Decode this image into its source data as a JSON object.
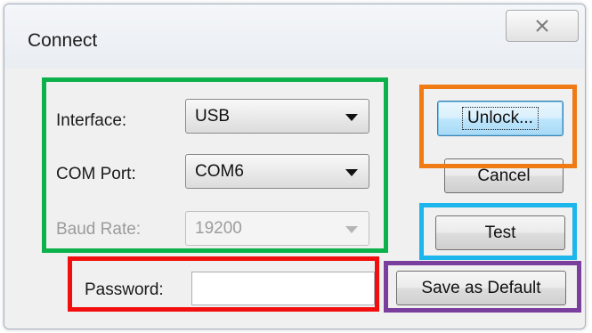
{
  "dialog": {
    "title": "Connect",
    "close_icon": "close-x-icon"
  },
  "fields": {
    "interface": {
      "label": "Interface:",
      "value": "USB"
    },
    "com_port": {
      "label": "COM Port:",
      "value": "COM6"
    },
    "baud_rate": {
      "label": "Baud Rate:",
      "value": "19200",
      "disabled": true
    },
    "password": {
      "label": "Password:",
      "value": ""
    }
  },
  "buttons": {
    "unlock": "Unlock...",
    "cancel": "Cancel",
    "test": "Test",
    "save_default": "Save as Default"
  },
  "highlights": {
    "connection_settings": "#0db14b",
    "password": "#f20e0e",
    "unlock": "#f07a14",
    "test": "#1cb5ec",
    "save_default": "#7a3f9d"
  }
}
